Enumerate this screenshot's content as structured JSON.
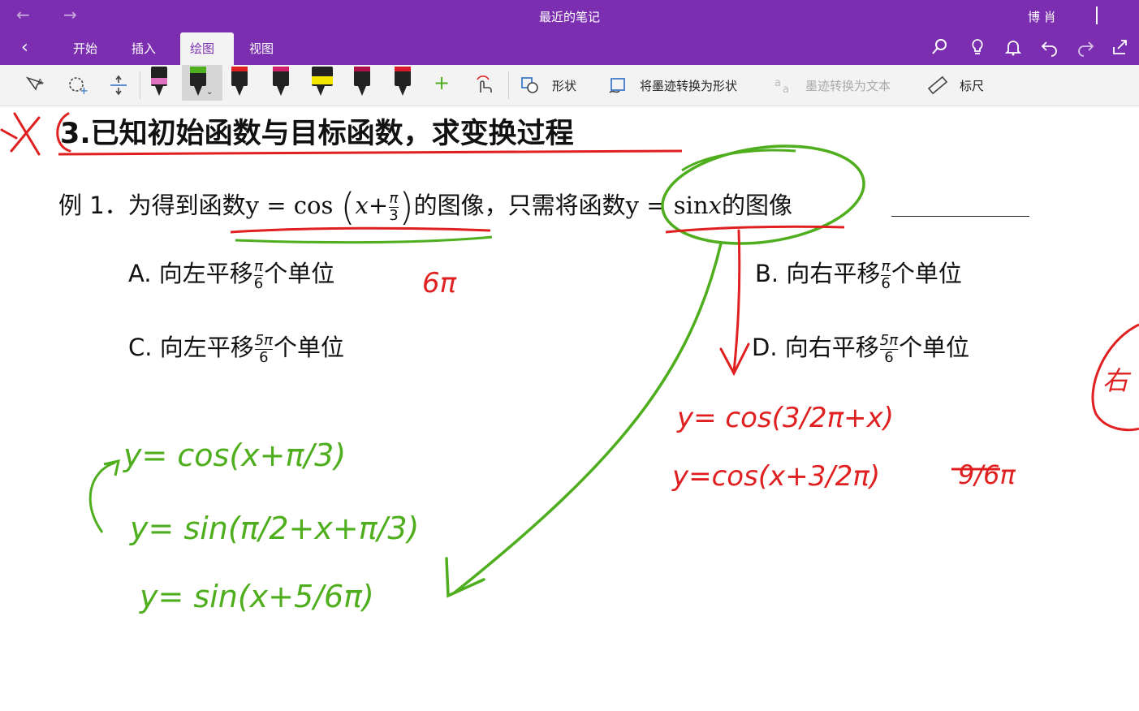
{
  "titlebar": {
    "back_glyph": "←",
    "forward_glyph": "→",
    "title": "最近的笔记",
    "user": "博 肖"
  },
  "ribbon": {
    "back_glyph": "‹",
    "tabs": [
      {
        "label": "开始",
        "active": false
      },
      {
        "label": "插入",
        "active": false
      },
      {
        "label": "绘图",
        "active": true
      },
      {
        "label": "视图",
        "active": false
      }
    ],
    "icons": [
      "search-icon",
      "lightbulb-icon",
      "bell-icon",
      "undo-icon",
      "redo-icon",
      "share-icon"
    ]
  },
  "toolbar": {
    "pens": [
      {
        "name": "pen-pink",
        "color": "#e070c0"
      },
      {
        "name": "pen-green",
        "color": "#4fae1e",
        "selected": true
      },
      {
        "name": "pen-red",
        "color": "#e02020"
      },
      {
        "name": "pen-magenta",
        "color": "#d0206a"
      },
      {
        "name": "highlighter-yellow",
        "color": "#f3e600"
      },
      {
        "name": "pen-crimson",
        "color": "#b0104a"
      },
      {
        "name": "pen-red-2",
        "color": "#d81b2c"
      }
    ],
    "shapes_label": "形状",
    "ink_to_shape_label": "将墨迹转换为形状",
    "ink_to_text_label": "墨迹转换为文本",
    "ruler_label": "标尺"
  },
  "note": {
    "heading": "3.已知初始函数与目标函数，求变换过程",
    "example_prefix": "例 1．为得到函数",
    "example_middle": "的图像，只需将函数",
    "example_suffix": "的图像",
    "func1": {
      "lead": "y = cos",
      "x": "x",
      "plus": "+",
      "num": "π",
      "den": "3"
    },
    "func2": {
      "lead": "y = sin",
      "x": "x"
    },
    "options": {
      "A": {
        "label": "A.",
        "text1": "向左平移",
        "num": "π",
        "den": "6",
        "text2": "个单位"
      },
      "B": {
        "label": "B.",
        "text1": "向右平移",
        "num": "π",
        "den": "6",
        "text2": "个单位"
      },
      "C": {
        "label": "C.",
        "text1": "向左平移",
        "num": "5π",
        "den": "6",
        "text2": "个单位"
      },
      "D": {
        "label": "D.",
        "text1": "向右平移",
        "num": "5π",
        "den": "6",
        "text2": "个单位"
      }
    }
  },
  "ink": {
    "red_color": "#e02020",
    "green_color": "#4fae1e",
    "red_note_A": "6π",
    "red_eq1": "y= cos(3/2π+x)",
    "red_eq2": "y=cos(x+3/2π)",
    "red_side": "9/6π",
    "red_far_right": "右",
    "green_eq1": "y= cos(x+π/3)",
    "green_eq2": "y= sin(π/2+x+π/3)",
    "green_eq3": "y= sin(x+5/6π)"
  }
}
